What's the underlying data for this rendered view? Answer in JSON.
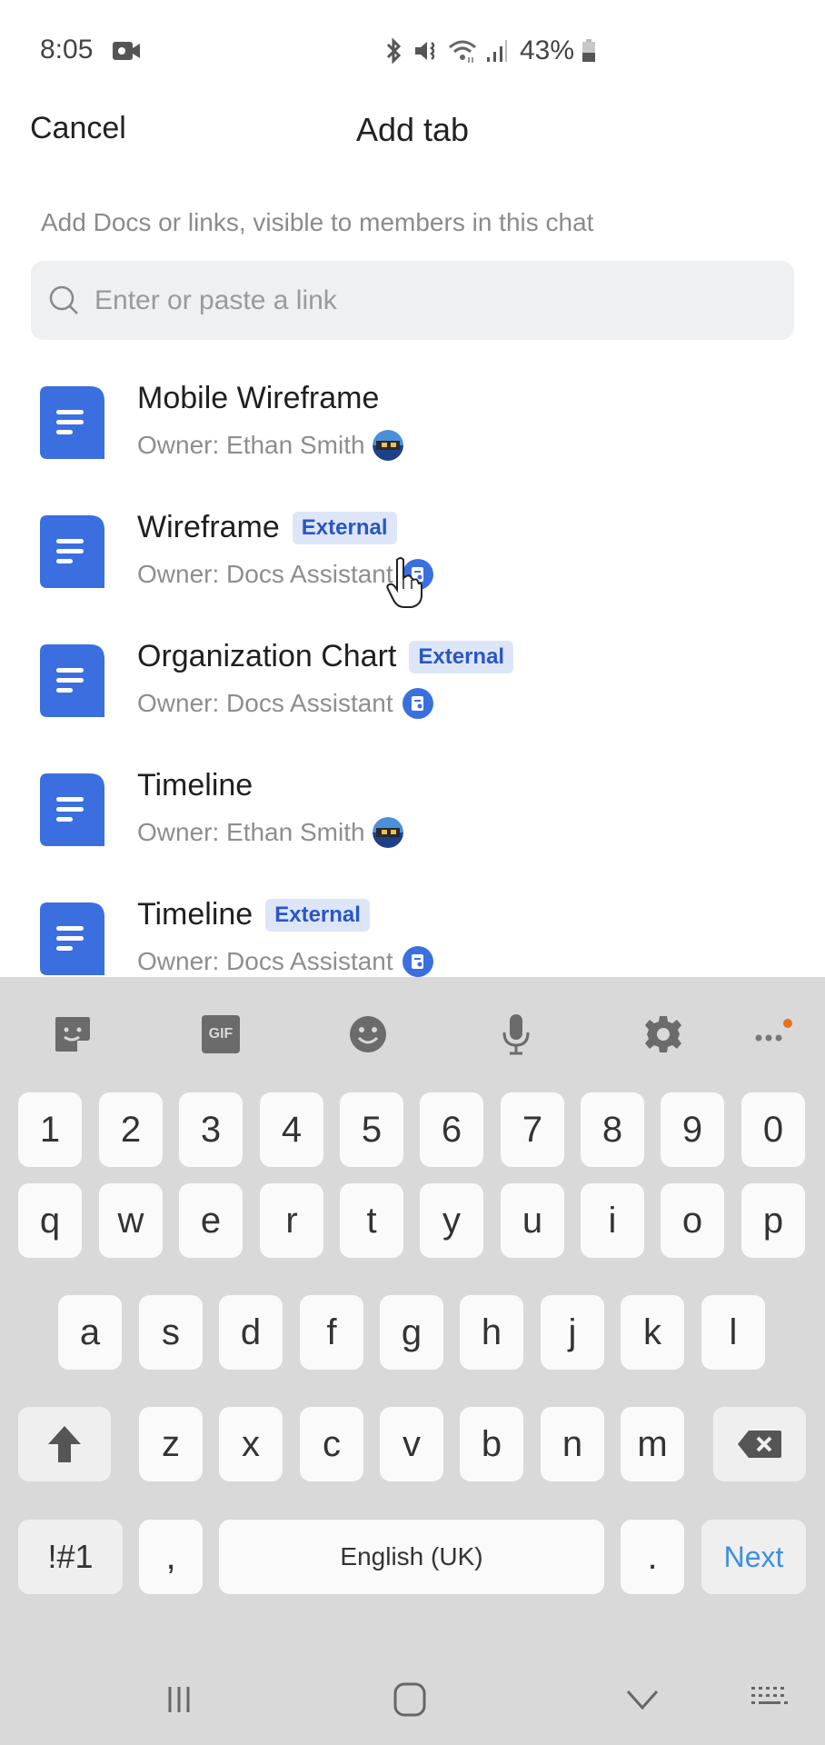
{
  "status_bar": {
    "time": "8:05",
    "battery": "43%",
    "icons": [
      "video-record-icon",
      "bluetooth-icon",
      "mute-vibrate-icon",
      "wifi-icon",
      "signal-icon",
      "battery-icon"
    ]
  },
  "header": {
    "cancel_label": "Cancel",
    "title": "Add tab"
  },
  "subtitle": "Add Docs or links, visible to members in this chat",
  "search": {
    "placeholder": "Enter or paste a link",
    "value": ""
  },
  "docs": [
    {
      "title": "Mobile Wireframe",
      "external": false,
      "owner": "Owner: Ethan Smith",
      "owner_avatar": "photo"
    },
    {
      "title": "Wireframe",
      "external": true,
      "owner": "Owner: Docs Assistant",
      "owner_avatar": "bot"
    },
    {
      "title": "Organization Chart",
      "external": true,
      "owner": "Owner: Docs Assistant",
      "owner_avatar": "bot"
    },
    {
      "title": "Timeline",
      "external": false,
      "owner": "Owner: Ethan Smith",
      "owner_avatar": "photo"
    },
    {
      "title": "Timeline",
      "external": true,
      "owner": "Owner: Docs Assistant",
      "owner_avatar": "bot"
    }
  ],
  "badge_label": "External",
  "colors": {
    "doc_icon": "#3b6fe0",
    "badge_bg": "#dde6f8",
    "badge_text": "#2a56c6",
    "keyboard_bg": "#d9d9d9",
    "next_key": "#3d8fe0",
    "notification_dot": "#e8711a"
  },
  "keyboard": {
    "toolbar": [
      "sticker-icon",
      "gif-icon",
      "emoji-icon",
      "mic-icon",
      "settings-icon",
      "more-icon"
    ],
    "gif_label": "GIF",
    "row_numbers": [
      "1",
      "2",
      "3",
      "4",
      "5",
      "6",
      "7",
      "8",
      "9",
      "0"
    ],
    "row_q": [
      "q",
      "w",
      "e",
      "r",
      "t",
      "y",
      "u",
      "i",
      "o",
      "p"
    ],
    "row_a": [
      "a",
      "s",
      "d",
      "f",
      "g",
      "h",
      "j",
      "k",
      "l"
    ],
    "row_z": [
      "z",
      "x",
      "c",
      "v",
      "b",
      "n",
      "m"
    ],
    "symbols_label": "!#1",
    "comma": ",",
    "space_label": "English (UK)",
    "period": ".",
    "action_label": "Next"
  },
  "nav_bar": [
    "recents-icon",
    "home-icon",
    "back-icon",
    "keyboard-switch-icon"
  ]
}
